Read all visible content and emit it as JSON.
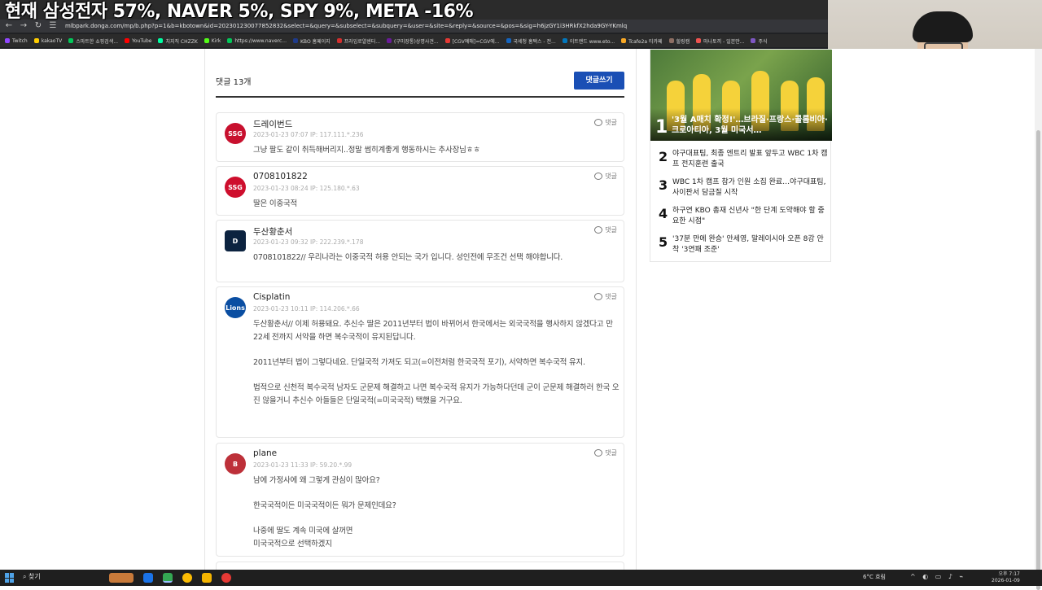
{
  "overlay": {
    "headline": "현재 삼성전자 57%, NAVER 5%, SPY 9%, META -16%"
  },
  "browser": {
    "url": "mlbpark.donga.com/mp/b.php?p=1&b=kbotown&id=202301230077852832&select=&query=&subselect=&subquery=&user=&site=&reply=&source=&pos=&sig=h6jzGY1i3HRkfX2hda9GY-YKmlq",
    "bookmarks": [
      "Twitch",
      "kakaoTV",
      "스마트한 쇼핑검색...",
      "YouTube",
      "치지직 CHZZK",
      "Kirk",
      "https://www.naverc...",
      "KBO 홈페이지",
      "프라임로얄센터...",
      "(구미장통)상명사견...",
      "[CGV예매]=CGV에...",
      "국세청 홈택스 - 전...",
      "이트랜드 www.eto...",
      "Tcafe2a 티카페",
      "힐링캠",
      "마나토끼 - 일본만...",
      "주식"
    ]
  },
  "comments": {
    "count_label": "댓글 13개",
    "write_button": "댓글쓰기",
    "reply_label": "댓글",
    "items": [
      {
        "author": "드레이번드",
        "meta": "2023-01-23 07:07  IP: 117.111.*.236",
        "team": "SSG",
        "body": [
          "그냥 팔도 같이 취득해버리지..정말 썸히계좋게 행동하시는 추사장님ㅎㅎ"
        ]
      },
      {
        "author": "0708101822",
        "meta": "2023-01-23 08:24  IP: 125.180.*.63",
        "team": "SSG",
        "body": [
          "딸은 이중국적"
        ]
      },
      {
        "author": "두산황춘서",
        "meta": "2023-01-23 09:32  IP: 222.239.*.178",
        "team": "D",
        "body": [
          "0708101822// 우리나라는 이중국적 허용 안되는 국가 입니다. 성인전에 무조건 선택 해야합니다."
        ]
      },
      {
        "author": "Cisplatin",
        "meta": "2023-01-23 10:11  IP: 114.206.*.66",
        "team": "Lions",
        "body": [
          "두산황춘서// 이제 허용돼요. 추신수 딸은 2011년부터 법이 바뀌어서 한국에서는 외국국적을 행사하지 않겠다고 만 22세 전까지 서약을 하면 복수국적이 유지된답니다.",
          "2011년부터 법이 그렇다네요. 단일국적 가져도 되고(=이전처럼 한국국적 포기), 서약하면 복수국적 유지.",
          "법적으로 신천적 복수국적 남자도 군문제 해결하고 나면 복수국적 유지가 가능하다던데 군이 군문제 해결하러 한국 오진 않을거니 추신수 아들들은 단일국적(=미국국적) 택했을 거구요."
        ]
      },
      {
        "author": "plane",
        "meta": "2023-01-23 11:33  IP: 59.20.*.99",
        "team": "B",
        "body": [
          "남에 가정사에 왜 그렇게 관심이 많아요?",
          "한국국적이든 미국국적이든 뭐가 문제인데요?",
          "나중에 딸도 계속 미국에 살꺼면\n미국국적으로 선택하겠지"
        ]
      }
    ]
  },
  "sidebar": {
    "top": {
      "rank": "1",
      "title": "'3월 A매치 확정!'…브라질·프랑스·콜롬비아·크로아티아, 3월 미국서…"
    },
    "items": [
      {
        "rank": "2",
        "title": "야구대표팀, 최종 엔트리 발표 앞두고 WBC 1차 캠프 전지훈련 출국"
      },
      {
        "rank": "3",
        "title": "WBC 1차 캠프 참가 인원 소집 완료…야구대표팀, 사이판서 담금질 시작"
      },
      {
        "rank": "4",
        "title": "하구연 KBO 총재 신년사 \"한 단계 도약해야 할 중요한 시점\""
      },
      {
        "rank": "5",
        "title": "'37분 만에 완승' 안세영, 말레이시아 오픈 8강 안착 '3연패 조준'"
      }
    ]
  },
  "taskbar": {
    "search": "찾기",
    "weather": "6°C 흐림",
    "time": "오후 7:17",
    "date": "2026-01-09"
  }
}
